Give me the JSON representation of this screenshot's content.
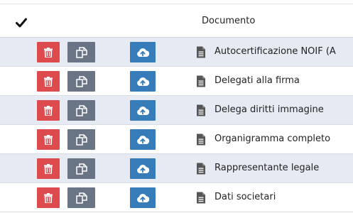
{
  "header": {
    "check_icon": "checkmark-icon",
    "document_column": "Documento"
  },
  "colors": {
    "delete": "#dd4b4f",
    "copy": "#697584",
    "upload": "#357cb9",
    "row_alt": "#e6eaf2"
  },
  "icons": {
    "delete": "trash-icon",
    "copy": "copy-icon",
    "upload": "cloud-upload-icon",
    "document": "document-icon"
  },
  "rows": [
    {
      "label": "Autocertificazione NOIF (A"
    },
    {
      "label": "Delegati alla firma"
    },
    {
      "label": "Delega diritti immagine"
    },
    {
      "label": "Organigramma completo"
    },
    {
      "label": "Rappresentante legale"
    },
    {
      "label": "Dati societari"
    }
  ]
}
